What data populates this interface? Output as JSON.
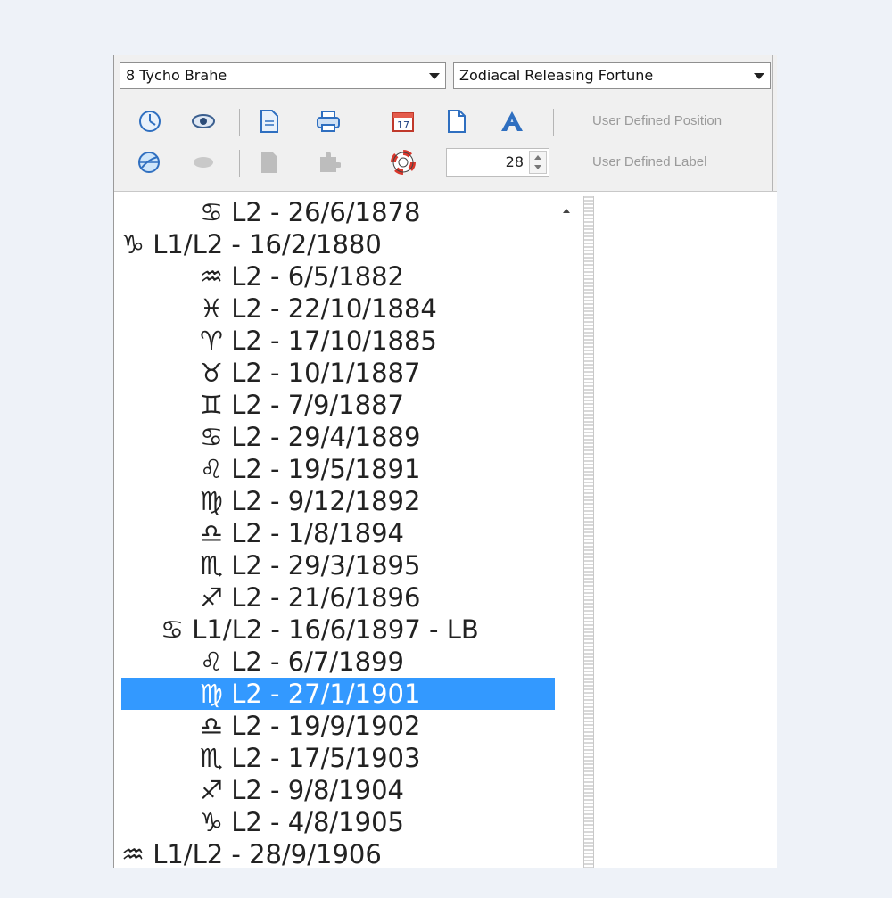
{
  "combos": {
    "chart": "8 Tycho Brahe",
    "technique": "Zodiacal Releasing Fortune"
  },
  "toolbar": {
    "row1_icons": [
      "clock-chart-icon",
      "eye-icon",
      "document-icon",
      "printer-icon",
      "calendar-icon",
      "blank-page-icon",
      "font-a-icon"
    ],
    "row2_icons": [
      "chart-wheel-icon",
      "oval-icon",
      "page-grey-icon",
      "puzzle-grey-icon",
      "lifebuoy-icon"
    ],
    "calendar_label": "17",
    "user_defined_position": "User Defined Position",
    "user_defined_label": "User Defined Label",
    "spin_value": "28"
  },
  "periods": [
    {
      "sym": "♋",
      "text": "L2 - 26/6/1878",
      "indent": 88
    },
    {
      "sym": "♑",
      "text": "L1/L2 - 16/2/1880",
      "indent": 0
    },
    {
      "sym": "♒",
      "text": "L2 - 6/5/1882",
      "indent": 88
    },
    {
      "sym": "♓",
      "text": "L2 - 22/10/1884",
      "indent": 88
    },
    {
      "sym": "♈",
      "text": "L2 - 17/10/1885",
      "indent": 88
    },
    {
      "sym": "♉",
      "text": "L2 - 10/1/1887",
      "indent": 88
    },
    {
      "sym": "♊",
      "text": "L2 - 7/9/1887",
      "indent": 88
    },
    {
      "sym": "♋",
      "text": "L2 - 29/4/1889",
      "indent": 88
    },
    {
      "sym": "♌",
      "text": "L2 - 19/5/1891",
      "indent": 88
    },
    {
      "sym": "♍",
      "text": "L2 - 9/12/1892",
      "indent": 88
    },
    {
      "sym": "♎",
      "text": "L2 - 1/8/1894",
      "indent": 88
    },
    {
      "sym": "♏",
      "text": "L2 - 29/3/1895",
      "indent": 88
    },
    {
      "sym": "♐",
      "text": "L2 - 21/6/1896",
      "indent": 88
    },
    {
      "sym": "♋",
      "text": "L1/L2 - 16/6/1897 - LB",
      "indent": 44
    },
    {
      "sym": "♌",
      "text": "L2 - 6/7/1899",
      "indent": 88
    },
    {
      "sym": "♍",
      "text": "L2 - 27/1/1901",
      "indent": 88,
      "selected": true
    },
    {
      "sym": "♎",
      "text": "L2 - 19/9/1902",
      "indent": 88
    },
    {
      "sym": "♏",
      "text": "L2 - 17/5/1903",
      "indent": 88
    },
    {
      "sym": "♐",
      "text": "L2 - 9/8/1904",
      "indent": 88
    },
    {
      "sym": "♑",
      "text": "L2 - 4/8/1905",
      "indent": 88
    },
    {
      "sym": "♒",
      "text": "L1/L2 - 28/9/1906",
      "indent": 0
    }
  ],
  "colors": {
    "selection": "#3399ff",
    "background": "#eef2f8"
  }
}
